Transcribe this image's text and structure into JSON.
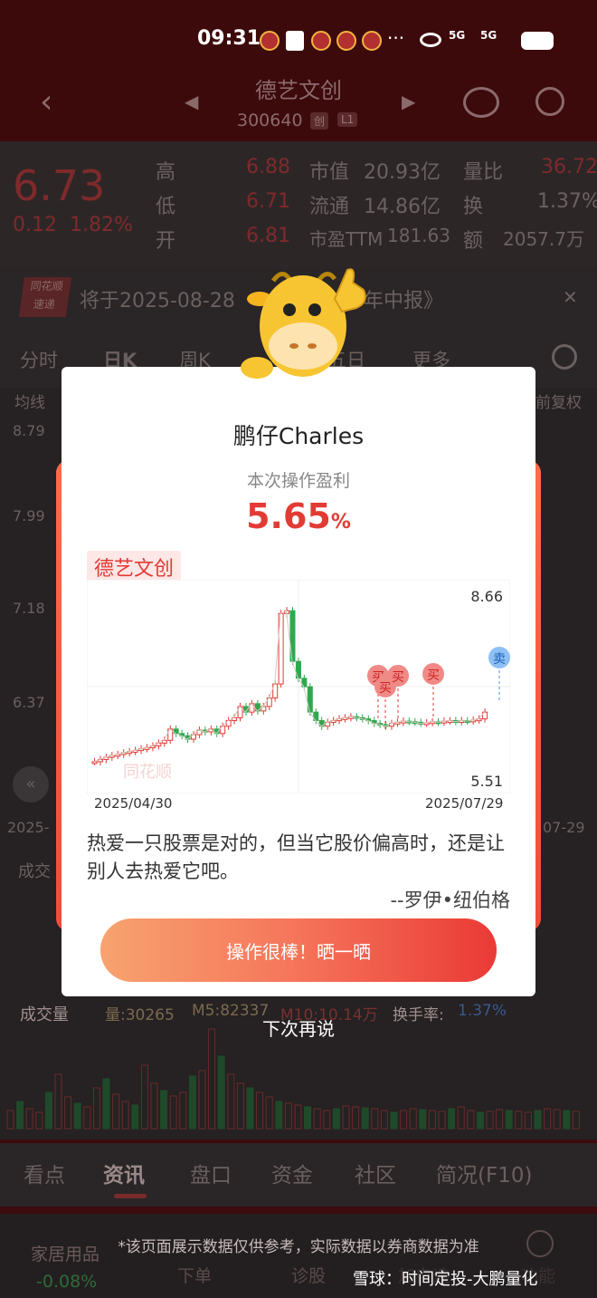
{
  "status_bar": {
    "time": "09:31",
    "network_a": "5G",
    "network_b": "5G"
  },
  "header": {
    "stock_name": "德艺文创",
    "stock_code": "300640",
    "tag_a": "创",
    "tag_b": "L1"
  },
  "quote": {
    "price": "6.73",
    "change": "0.12",
    "change_pct": "1.82%",
    "rows": [
      {
        "l1": "高",
        "v1": "6.88",
        "l2": "市值",
        "v2": "20.93亿",
        "l3": "量比",
        "v3": "36.72"
      },
      {
        "l1": "低",
        "v1": "6.71",
        "l2": "流通",
        "v2": "14.86亿",
        "l3": "换",
        "v3": "1.37%"
      },
      {
        "l1": "开",
        "v1": "6.81",
        "l2": "市盈TTM",
        "v2": "181.63",
        "l3": "额",
        "v3": "2057.7万"
      }
    ]
  },
  "news": {
    "logo_top": "同花顺",
    "logo_bottom": "速递",
    "text": "将于2025-08-28",
    "text_tail": "年中报》"
  },
  "kline_tabs": [
    "分时",
    "日K",
    "周K",
    "五日",
    "更多"
  ],
  "kline_controls": {
    "ma": "均线",
    "adjust": "前复权"
  },
  "price_axis": [
    "8.79",
    "7.99",
    "7.18",
    "6.37"
  ],
  "left_date": "2025-",
  "right_date": "07-29",
  "volume_panel": {
    "label": "成交量",
    "vol": "量:30265",
    "m5": "M5:82337",
    "m10": "M10:10.14万",
    "turnover_label": "换手率:",
    "turnover": "1.37%",
    "upper_label": "成交"
  },
  "bottom_tabs": [
    "看点",
    "资讯",
    "盘口",
    "资金",
    "社区",
    "简况(F10)"
  ],
  "footer": {
    "sector": "家居用品",
    "sector_chg": "-0.08%",
    "btn1": "下单",
    "btn2": "诊股",
    "btn3": "加自选",
    "btn4": "功能",
    "disclaimer": "*该页面展示数据仅供参考，实际数据以券商数据为准"
  },
  "popup": {
    "user": "鹏仔Charles",
    "label": "本次操作盈利",
    "profit": "5.65",
    "profit_unit": "%",
    "stock": "德艺文创",
    "chart_high": "8.66",
    "chart_low": "5.51",
    "date_start": "2025/04/30",
    "date_end": "2025/07/29",
    "buy_marks": [
      "买",
      "买",
      "买",
      "买"
    ],
    "sell_mark": "卖",
    "chart_watermark": "同花顺",
    "quote": "热爱一只股票是对的，但当它股价偏高时，还是让别人去热爱它吧。",
    "author": "--罗伊•纽伯格",
    "share_button": "操作很棒！晒一晒",
    "later": "下次再说"
  },
  "watermark": "雪球：时间定投-大鹏量化",
  "colors": {
    "up": "#e23b34",
    "down": "#2fa84f",
    "accent": "#e23b34",
    "sell": "#4a90e2"
  }
}
